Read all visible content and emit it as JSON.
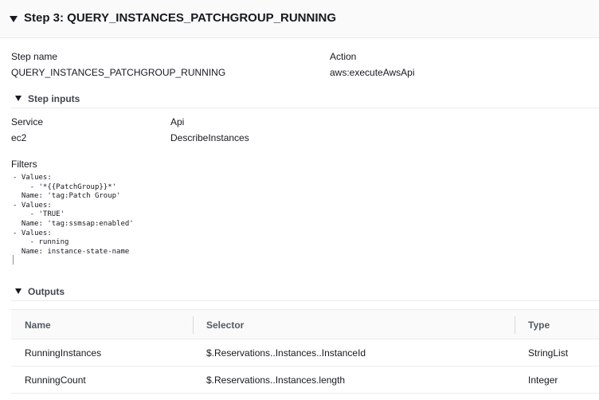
{
  "step": {
    "title": "Step 3: QUERY_INSTANCES_PATCHGROUP_RUNNING"
  },
  "details": {
    "step_name_label": "Step name",
    "step_name_value": "QUERY_INSTANCES_PATCHGROUP_RUNNING",
    "action_label": "Action",
    "action_value": "aws:executeAwsApi"
  },
  "step_inputs": {
    "heading": "Step inputs",
    "service_label": "Service",
    "service_value": "ec2",
    "api_label": "Api",
    "api_value": "DescribeInstances",
    "filters_label": "Filters",
    "filters_code": "- Values:\n    - '*{{PatchGroup}}*'\n  Name: 'tag:Patch Group'\n- Values:\n    - 'TRUE'\n  Name: 'tag:ssmsap:enabled'\n- Values:\n    - running\n  Name: instance-state-name"
  },
  "outputs": {
    "heading": "Outputs",
    "columns": [
      "Name",
      "Selector",
      "Type"
    ],
    "rows": [
      {
        "name": "RunningInstances",
        "selector": "$.Reservations..Instances..InstanceId",
        "type": "StringList"
      },
      {
        "name": "RunningCount",
        "selector": "$.Reservations..Instances.length",
        "type": "Integer"
      }
    ]
  }
}
